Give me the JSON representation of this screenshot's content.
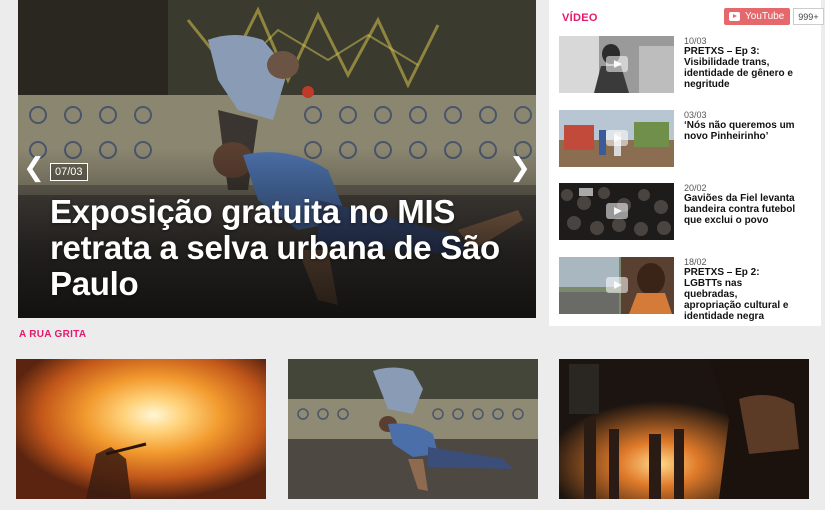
{
  "hero": {
    "date": "07/03",
    "title": "Exposição gratuita no MIS retrata a selva urbana de São Paulo",
    "prev_icon": "chevron-left-icon",
    "next_icon": "chevron-right-icon"
  },
  "video": {
    "heading": "VÍDEO",
    "youtube_label": "YouTube",
    "youtube_count": "999+",
    "items": [
      {
        "date": "10/03",
        "title": "PRETXS – Ep 3: Visibilidade trans, identidade de gênero e negritude"
      },
      {
        "date": "03/03",
        "title": "‘Nós não queremos um novo Pinheirinho’"
      },
      {
        "date": "20/02",
        "title": "Gaviões da Fiel levanta bandeira contra futebol que exclui o povo"
      },
      {
        "date": "18/02",
        "title": "PRETXS – Ep 2: LGBTTs nas quebradas, apropriação cultural e identidade negra"
      }
    ]
  },
  "section": {
    "heading": "A RUA GRITA"
  },
  "colors": {
    "accent": "#e6176b",
    "youtube": "#e5686c",
    "background": "#ececec"
  }
}
